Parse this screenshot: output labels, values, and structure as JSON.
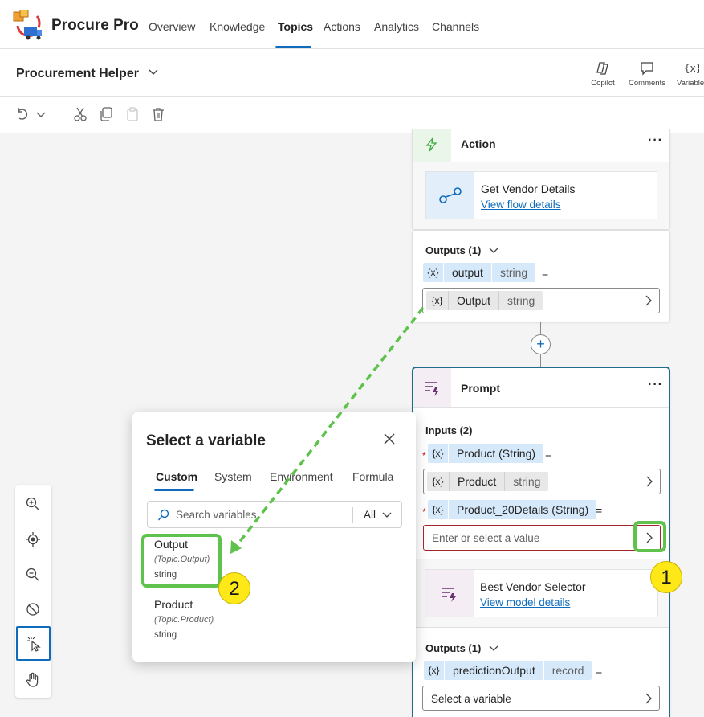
{
  "app": {
    "brand": "Procure Pro"
  },
  "nav": {
    "tabs": [
      {
        "label": "Overview"
      },
      {
        "label": "Knowledge"
      },
      {
        "label": "Topics"
      },
      {
        "label": "Actions"
      },
      {
        "label": "Analytics"
      },
      {
        "label": "Channels"
      }
    ],
    "active": "Topics"
  },
  "header": {
    "bot_name": "Procurement Helper",
    "buttons": {
      "copilot": "Copilot",
      "comments": "Comments",
      "variables": "Variable"
    }
  },
  "action_node": {
    "title": "Action",
    "flow_name": "Get Vendor Details",
    "flow_link": "View flow details",
    "outputs_label": "Outputs (1)",
    "output_var": {
      "icon_text": "{x}",
      "name": "output",
      "type": "string",
      "eq": "="
    },
    "output_value": {
      "icon_text": "{x}",
      "name": "Output",
      "type": "string"
    }
  },
  "prompt_node": {
    "title": "Prompt",
    "inputs_label": "Inputs (2)",
    "input1": {
      "icon_text": "{x}",
      "name": "Product (String)",
      "eq": "=",
      "value_name": "Product",
      "value_type": "string"
    },
    "input2": {
      "icon_text": "{x}",
      "name": "Product_20Details (String)",
      "eq": "=",
      "placeholder": "Enter or select a value"
    },
    "model_name": "Best Vendor Selector",
    "model_link": "View model details",
    "outputs_label": "Outputs (1)",
    "output_var": {
      "icon_text": "{x}",
      "name": "predictionOutput",
      "type": "record",
      "eq": "="
    },
    "select_placeholder": "Select a variable"
  },
  "popup": {
    "title": "Select a variable",
    "tabs": [
      {
        "label": "Custom"
      },
      {
        "label": "System"
      },
      {
        "label": "Environment"
      },
      {
        "label": "Formula"
      }
    ],
    "search_placeholder": "Search variables",
    "filter": "All",
    "items": [
      {
        "name": "Output",
        "path": "(Topic.Output)",
        "type": "string"
      },
      {
        "name": "Product",
        "path": "(Topic.Product)",
        "type": "string"
      }
    ]
  },
  "callouts": {
    "one": "1",
    "two": "2"
  },
  "colors": {
    "accent": "#0f6cbd",
    "highlight": "#5ec24c",
    "callout": "#ffe817",
    "prompt_border": "#1f6f8b"
  }
}
